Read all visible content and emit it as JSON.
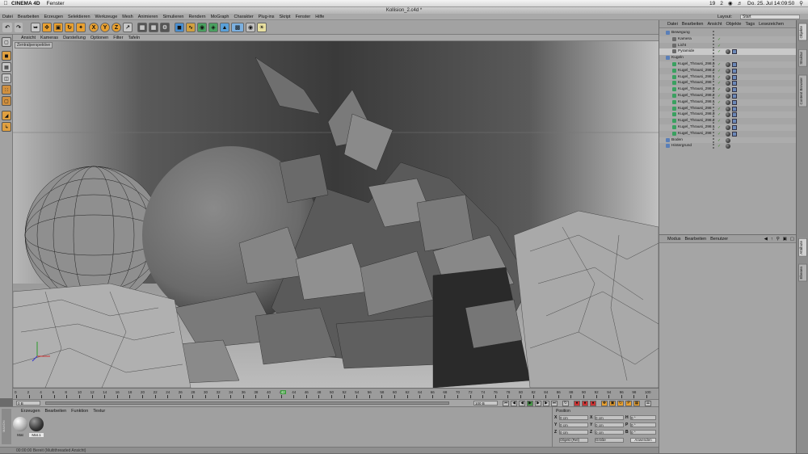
{
  "macbar": {
    "apple": "",
    "app": "CINEMA 4D",
    "menu": [
      "Fenster"
    ],
    "status_date": "Do. 25. Jul  14:09:50",
    "status_icons": [
      "19",
      "2"
    ]
  },
  "window": {
    "title": "Kollision_2.c4d *"
  },
  "c4d_menu": [
    "Datei",
    "Bearbeiten",
    "Erzeugen",
    "Selektieren",
    "Werkzeuge",
    "Mesh",
    "Animieren",
    "Simulieren",
    "Rendern",
    "MoGraph",
    "Charakter",
    "Plug-ins",
    "Skript",
    "Fenster",
    "Hilfe"
  ],
  "layout": {
    "label": "Layout:",
    "value": "Start"
  },
  "toolbar": {
    "x_label": "X",
    "y_label": "Y",
    "z_label": "Z"
  },
  "viewport": {
    "menu": [
      "Ansicht",
      "Kameras",
      "Darstellung",
      "Optionen",
      "Filter",
      "Tafeln"
    ],
    "label": "Zentralperspektive"
  },
  "timeline": {
    "ticks": [
      "0",
      "2",
      "4",
      "6",
      "8",
      "10",
      "12",
      "14",
      "16",
      "18",
      "20",
      "22",
      "24",
      "26",
      "28",
      "30",
      "32",
      "34",
      "36",
      "38",
      "40",
      "42",
      "44",
      "46",
      "48",
      "50",
      "52",
      "54",
      "56",
      "58",
      "60",
      "62",
      "64",
      "66",
      "68",
      "70",
      "72",
      "74",
      "76",
      "78",
      "80",
      "82",
      "84",
      "86",
      "88",
      "90",
      "92",
      "94",
      "96",
      "98",
      "100"
    ],
    "current_frame": "0 B",
    "marker": "42",
    "end_frame": "100 B"
  },
  "transport": {
    "start": "0 B",
    "end": "100 B",
    "frame_field": "0 B"
  },
  "materials": {
    "menu": [
      "Erzeugen",
      "Bearbeiten",
      "Funktion",
      "Textur"
    ],
    "items": [
      {
        "label": "Mat"
      },
      {
        "label": "Mat.1"
      }
    ]
  },
  "coords": {
    "header": "Position",
    "rows": [
      {
        "axis": "X",
        "val": "0 cm",
        "axis2": "X",
        "val2": "0 cm",
        "axis3": "H",
        "val3": "0 °"
      },
      {
        "axis": "Y",
        "val": "0 cm",
        "axis2": "Y",
        "val2": "0 cm",
        "axis3": "P",
        "val3": "0 °"
      },
      {
        "axis": "Z",
        "val": "0 cm",
        "axis2": "Z",
        "val2": "0 cm",
        "axis3": "B",
        "val3": "0 °"
      }
    ],
    "mode": "Objekt (Rel)",
    "size": "Größe",
    "apply": "Anwenden"
  },
  "status": {
    "text": "00:00:00   Bereit (Multithreaded Ansicht)"
  },
  "objmgr": {
    "menu": [
      "Datei",
      "Bearbeiten",
      "Ansicht",
      "Objekte",
      "Tags",
      "Lesezeichen"
    ],
    "rows": [
      {
        "name": "Bewegung",
        "indent": 0,
        "tags": 0
      },
      {
        "name": "Kamera",
        "indent": 1,
        "tags": 0
      },
      {
        "name": "Licht",
        "indent": 1,
        "tags": 0
      },
      {
        "name": "Pyramide",
        "indent": 1,
        "tags": 2
      },
      {
        "name": "Kugeln",
        "indent": 0,
        "tags": 0
      },
      {
        "name": "Kugel_Thrausi_298.5",
        "indent": 1,
        "tags": 2
      },
      {
        "name": "Kugel_Thrausi_298.2",
        "indent": 1,
        "tags": 2
      },
      {
        "name": "Kugel_Thrausi_298.1",
        "indent": 1,
        "tags": 2
      },
      {
        "name": "Kugel_Thrausi_298",
        "indent": 1,
        "tags": 2
      },
      {
        "name": "Kugel_Thrausi_298.3",
        "indent": 1,
        "tags": 2
      },
      {
        "name": "Kugel_Thrausi_298.2",
        "indent": 1,
        "tags": 2
      },
      {
        "name": "Kugel_Thrausi_298.1",
        "indent": 1,
        "tags": 2
      },
      {
        "name": "Kugel_Thrausi_298",
        "indent": 1,
        "tags": 2
      },
      {
        "name": "Kugel_Thrausi_298.3",
        "indent": 1,
        "tags": 2
      },
      {
        "name": "Kugel_Thrausi_298.2",
        "indent": 1,
        "tags": 2
      },
      {
        "name": "Kugel_Thrausi_298.1",
        "indent": 1,
        "tags": 2
      },
      {
        "name": "Kugel_Thrausi_298",
        "indent": 1,
        "tags": 2
      },
      {
        "name": "Boden",
        "indent": 0,
        "tags": 1
      },
      {
        "name": "Hintergrund",
        "indent": 0,
        "tags": 1
      }
    ]
  },
  "attrmgr": {
    "menu": [
      "Modus",
      "Bearbeiten",
      "Benutzer"
    ]
  },
  "right_tabs": [
    "Objekte",
    "Struktur",
    "Content Browser",
    "Attribute",
    "Ebenen"
  ]
}
